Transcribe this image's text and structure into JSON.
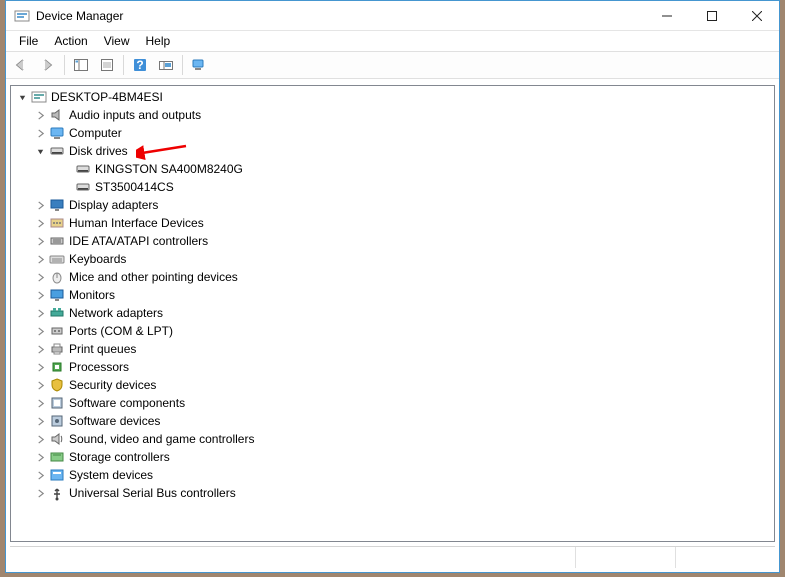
{
  "window": {
    "title": "Device Manager"
  },
  "menu": {
    "file": "File",
    "action": "Action",
    "view": "View",
    "help": "Help"
  },
  "tree": {
    "root": "DESKTOP-4BM4ESI",
    "nodes": [
      {
        "label": "Audio inputs and outputs",
        "icon": "audio"
      },
      {
        "label": "Computer",
        "icon": "computer"
      },
      {
        "label": "Disk drives",
        "icon": "disk",
        "expanded": true,
        "children": [
          {
            "label": "KINGSTON SA400M8240G",
            "icon": "disk"
          },
          {
            "label": "ST3500414CS",
            "icon": "disk"
          }
        ]
      },
      {
        "label": "Display adapters",
        "icon": "display"
      },
      {
        "label": "Human Interface Devices",
        "icon": "hid"
      },
      {
        "label": "IDE ATA/ATAPI controllers",
        "icon": "ide"
      },
      {
        "label": "Keyboards",
        "icon": "keyboard"
      },
      {
        "label": "Mice and other pointing devices",
        "icon": "mouse"
      },
      {
        "label": "Monitors",
        "icon": "monitor"
      },
      {
        "label": "Network adapters",
        "icon": "network"
      },
      {
        "label": "Ports (COM & LPT)",
        "icon": "port"
      },
      {
        "label": "Print queues",
        "icon": "printer"
      },
      {
        "label": "Processors",
        "icon": "cpu"
      },
      {
        "label": "Security devices",
        "icon": "security"
      },
      {
        "label": "Software components",
        "icon": "swcomp"
      },
      {
        "label": "Software devices",
        "icon": "swdev"
      },
      {
        "label": "Sound, video and game controllers",
        "icon": "sound"
      },
      {
        "label": "Storage controllers",
        "icon": "storage"
      },
      {
        "label": "System devices",
        "icon": "system"
      },
      {
        "label": "Universal Serial Bus controllers",
        "icon": "usb"
      }
    ]
  }
}
